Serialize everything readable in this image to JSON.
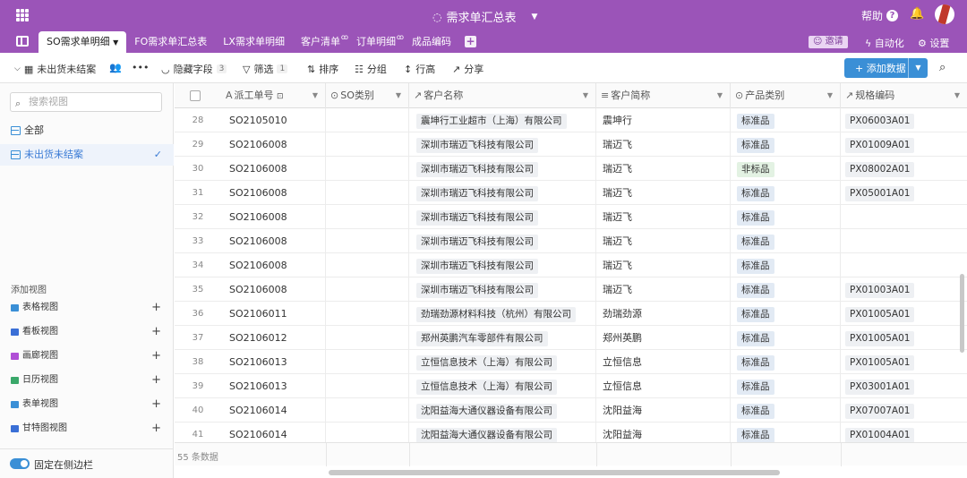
{
  "app": {
    "title": "需求单汇总表",
    "help": "帮助"
  },
  "tabs": [
    {
      "label": "SO需求单明细"
    },
    {
      "label": "FO需求单汇总表"
    },
    {
      "label": "LX需求单明细"
    },
    {
      "label": "客户清单"
    },
    {
      "label": "订单明细"
    },
    {
      "label": "成品编码"
    }
  ],
  "header_actions": {
    "invite": "邀请",
    "automation": "自动化",
    "settings": "设置"
  },
  "toolbar": {
    "view_name": "未出货未结案",
    "hidden_fields": "隐藏字段",
    "hidden_count": "3",
    "filter": "筛选",
    "filter_count": "1",
    "sort": "排序",
    "group": "分组",
    "row_height": "行高",
    "share": "分享",
    "add_data": "添加数据"
  },
  "sidebar": {
    "search_placeholder": "搜索视图",
    "views": [
      {
        "label": "全部"
      },
      {
        "label": "未出货未结案"
      }
    ],
    "add_view_title": "添加视图",
    "view_types": [
      {
        "label": "表格视图",
        "color": "#3a8fd6"
      },
      {
        "label": "看板视图",
        "color": "#3a6fd6"
      },
      {
        "label": "画廊视图",
        "color": "#b04fd6"
      },
      {
        "label": "日历视图",
        "color": "#3aa86a"
      },
      {
        "label": "表单视图",
        "color": "#3a8fd6"
      },
      {
        "label": "甘特图视图",
        "color": "#3a6fd6"
      }
    ],
    "pin_label": "固定在侧边栏"
  },
  "columns": [
    "派工单号",
    "SO类别",
    "客户名称",
    "客户简称",
    "产品类别",
    "规格编码"
  ],
  "rows": [
    {
      "n": "28",
      "so": "SO2105010",
      "cust": "震坤行工业超市（上海）有限公司",
      "short": "震坤行",
      "cat": "标准品",
      "code": "PX06003A01"
    },
    {
      "n": "29",
      "so": "SO2106008",
      "cust": "深圳市瑞迈飞科技有限公司",
      "short": "瑞迈飞",
      "cat": "标准品",
      "code": "PX01009A01"
    },
    {
      "n": "30",
      "so": "SO2106008",
      "cust": "深圳市瑞迈飞科技有限公司",
      "short": "瑞迈飞",
      "cat": "非标品",
      "code": "PX08002A01"
    },
    {
      "n": "31",
      "so": "SO2106008",
      "cust": "深圳市瑞迈飞科技有限公司",
      "short": "瑞迈飞",
      "cat": "标准品",
      "code": "PX05001A01"
    },
    {
      "n": "32",
      "so": "SO2106008",
      "cust": "深圳市瑞迈飞科技有限公司",
      "short": "瑞迈飞",
      "cat": "标准品",
      "code": ""
    },
    {
      "n": "33",
      "so": "SO2106008",
      "cust": "深圳市瑞迈飞科技有限公司",
      "short": "瑞迈飞",
      "cat": "标准品",
      "code": ""
    },
    {
      "n": "34",
      "so": "SO2106008",
      "cust": "深圳市瑞迈飞科技有限公司",
      "short": "瑞迈飞",
      "cat": "标准品",
      "code": ""
    },
    {
      "n": "35",
      "so": "SO2106008",
      "cust": "深圳市瑞迈飞科技有限公司",
      "short": "瑞迈飞",
      "cat": "标准品",
      "code": "PX01003A01"
    },
    {
      "n": "36",
      "so": "SO2106011",
      "cust": "劲瑞劲源材料科技（杭州）有限公司",
      "short": "劲瑞劲源",
      "cat": "标准品",
      "code": "PX01005A01"
    },
    {
      "n": "37",
      "so": "SO2106012",
      "cust": "郑州英鹏汽车零部件有限公司",
      "short": "郑州英鹏",
      "cat": "标准品",
      "code": "PX01005A01"
    },
    {
      "n": "38",
      "so": "SO2106013",
      "cust": "立恒信息技术（上海）有限公司",
      "short": "立恒信息",
      "cat": "标准品",
      "code": "PX01005A01"
    },
    {
      "n": "39",
      "so": "SO2106013",
      "cust": "立恒信息技术（上海）有限公司",
      "short": "立恒信息",
      "cat": "标准品",
      "code": "PX03001A01"
    },
    {
      "n": "40",
      "so": "SO2106014",
      "cust": "沈阳益海大通仪器设备有限公司",
      "short": "沈阳益海",
      "cat": "标准品",
      "code": "PX07007A01"
    },
    {
      "n": "41",
      "so": "SO2106014",
      "cust": "沈阳益海大通仪器设备有限公司",
      "short": "沈阳益海",
      "cat": "标准品",
      "code": "PX01004A01"
    }
  ],
  "footer": {
    "count": "55 条数据"
  },
  "colors": {
    "brand": "#9b54b8",
    "accent": "#3a8fd6"
  }
}
